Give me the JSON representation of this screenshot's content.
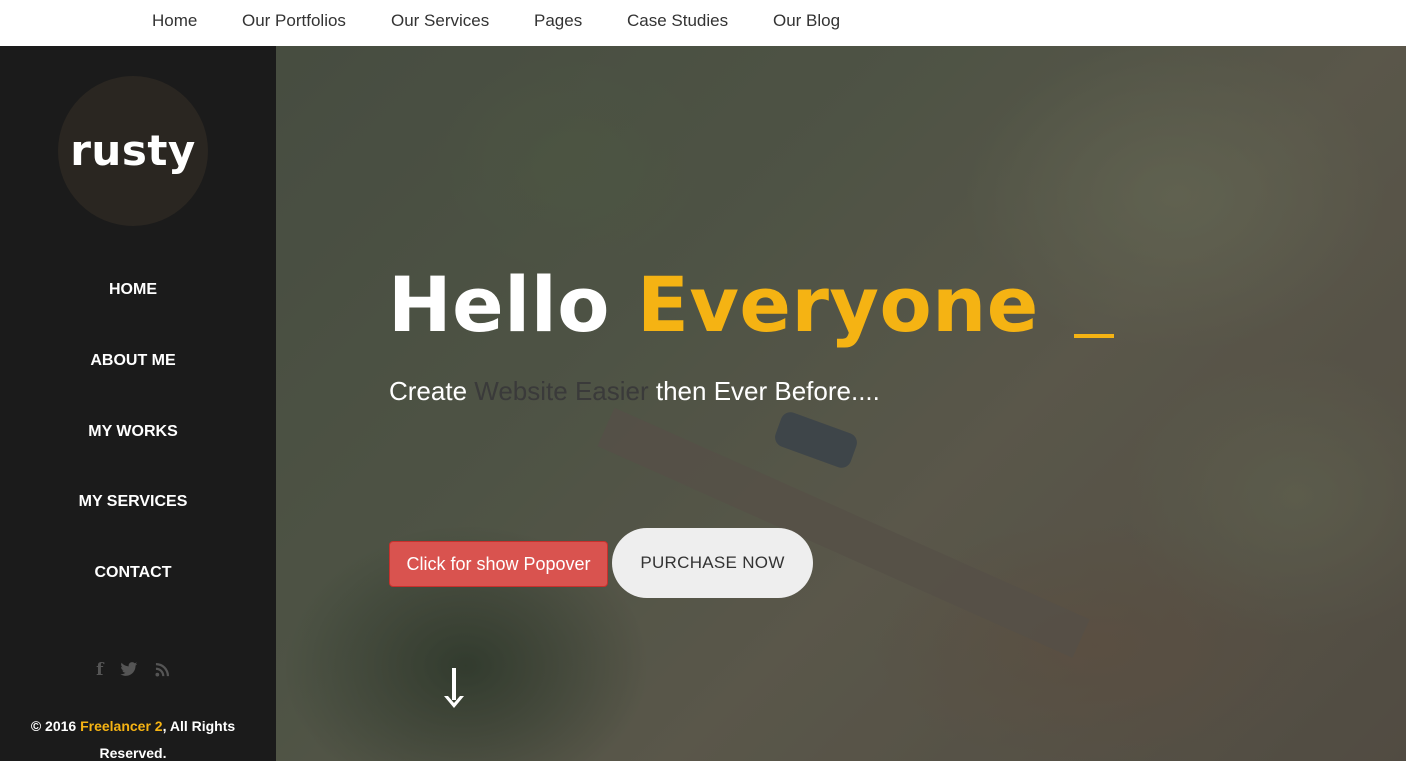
{
  "topnav": {
    "items": [
      "Home",
      "Our Portfolios",
      "Our Services",
      "Pages",
      "Case Studies",
      "Our Blog"
    ]
  },
  "sidebar": {
    "logo": "rusty",
    "menu": [
      "HOME",
      "ABOUT ME",
      "MY WORKS",
      "MY SERVICES",
      "CONTACT"
    ],
    "social_icons": [
      "facebook-icon",
      "twitter-icon",
      "rss-icon"
    ],
    "copyright": {
      "prefix": "© 2016 ",
      "brand": "Freelancer 2",
      "suffix": ", All Rights Reserved."
    }
  },
  "hero": {
    "title_white": "Hello ",
    "title_accent": "Everyone",
    "subtitle_start": "Create ",
    "subtitle_dim": "Website Easier",
    "subtitle_end": " then Ever Before....",
    "popover_button": "Click for show Popover",
    "purchase_button": "PURCHASE NOW",
    "scroll_icon": "arrow-down-icon"
  },
  "colors": {
    "accent": "#f5b313",
    "sidebar_bg": "#1b1b1b",
    "danger_button": "#d9534f",
    "purchase_button": "#eeeeee"
  }
}
